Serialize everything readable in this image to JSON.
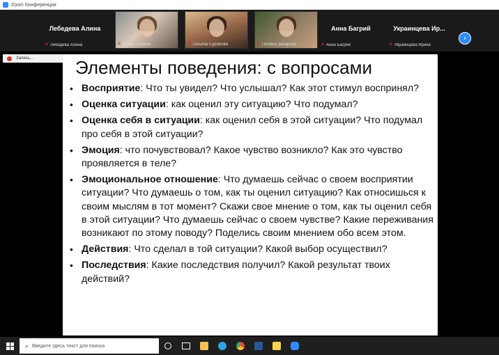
{
  "window": {
    "title": "Zoom Конференция"
  },
  "gallery": {
    "tiles": [
      {
        "name": "Лебедева Алина",
        "label": "Лебедева Алина"
      },
      {
        "name": "",
        "label": "Ирина Бабина"
      },
      {
        "name": "",
        "label": "Татьяна Сурабова"
      },
      {
        "name": "",
        "label": "Полина Захарова"
      },
      {
        "name": "Анна Багрий",
        "label": "Анна Багрий"
      },
      {
        "name": "Украинцева Ир...",
        "label": "Украинцева Ирина"
      }
    ],
    "next_icon": "chevron-right-icon",
    "mute_icon": "muted-mic-icon"
  },
  "share": {
    "label": "Запись..."
  },
  "slide": {
    "title": "Элементы поведения: с вопросами",
    "items": [
      {
        "term": "Восприятие",
        "text": ": Что ты увидел? Что услышал? Как этот стимул воспринял?"
      },
      {
        "term": "Оценка ситуации",
        "text": ": как оценил эту ситуацию? Что подумал?"
      },
      {
        "term": "Оценка себя в ситуации",
        "text": ": как оценил себя в этой ситуации? Что подумал про себя в этой ситуации?"
      },
      {
        "term": "Эмоция",
        "text": ": что почувствовал? Какое чувство возникло? Как это чувство проявляется в теле?"
      },
      {
        "term": "Эмоциональное отношение",
        "text": ": Что думаешь сейчас о своем восприятии ситуации? Что думаешь о том, как ты оценил ситуацию? Как относишься к своим мыслям в тот момент? Скажи свое мнение о том, как ты оценил себя в этой ситуации? Что думаешь сейчас о своем чувстве? Какие переживания возникают по этому поводу? Поделись своим мнением обо всем этом."
      },
      {
        "term": "Действия",
        "text": ": Что сделал в той ситуации? Какой выбор осуществил?"
      },
      {
        "term": "Последствия",
        "text": ": Какие последствия получил? Какой результат твоих действий?"
      }
    ]
  },
  "taskbar": {
    "search_placeholder": "Введите здесь текст для поиска",
    "apps": [
      {
        "name": "cortana",
        "color": "#ffffff"
      },
      {
        "name": "task-view",
        "color": "#ffffff"
      },
      {
        "name": "file-explorer",
        "color": "#f2c14e"
      },
      {
        "name": "edge",
        "color": "#2fa4e7"
      },
      {
        "name": "chrome",
        "color": "#e8453c"
      },
      {
        "name": "word",
        "color": "#2b579a"
      },
      {
        "name": "sticky-notes",
        "color": "#f7d44a"
      },
      {
        "name": "zoom",
        "color": "#2d8cff"
      }
    ]
  }
}
